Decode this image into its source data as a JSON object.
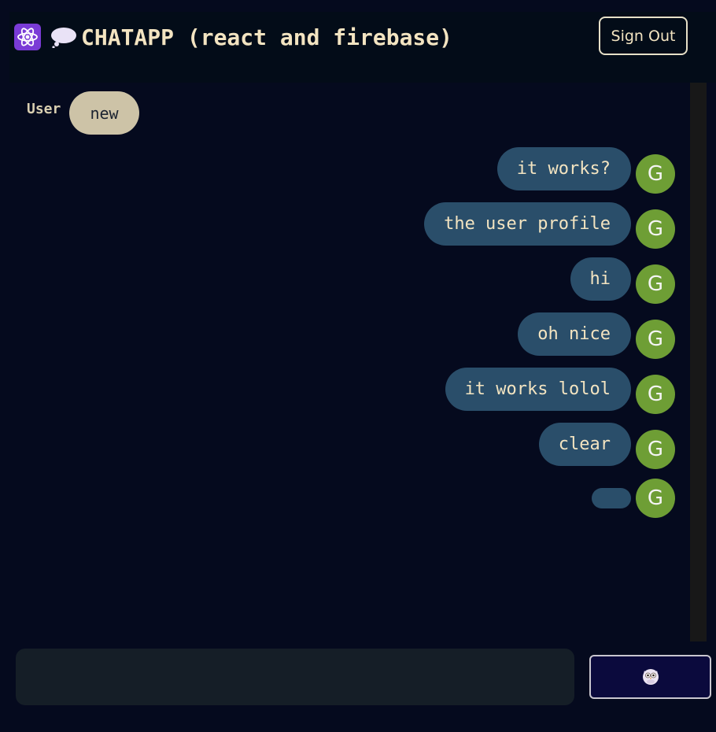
{
  "header": {
    "logo_icon": "react-atom-icon",
    "bubble_icon": "thought-bubble-icon",
    "title": "CHATAPP (react and firebase)",
    "signout_label": "Sign Out"
  },
  "system_message": {
    "user_label": "User",
    "text": "new"
  },
  "messages": [
    {
      "text": "it works?",
      "avatar": "G"
    },
    {
      "text": "the user profile",
      "avatar": "G"
    },
    {
      "text": "hi",
      "avatar": "G"
    },
    {
      "text": "oh nice",
      "avatar": "G"
    },
    {
      "text": "it works lolol",
      "avatar": "G"
    },
    {
      "text": "clear",
      "avatar": "G"
    },
    {
      "text": "",
      "avatar": "G"
    }
  ],
  "composer": {
    "value": "",
    "placeholder": ""
  },
  "send_button": {
    "icon": "owl-icon"
  },
  "colors": {
    "background": "#050a1e",
    "header": "#030c18",
    "accent_text": "#f3e4c1",
    "bubble": "#2a4e6a",
    "avatar": "#6e9e35",
    "system_bubble": "#cdc3a7"
  }
}
